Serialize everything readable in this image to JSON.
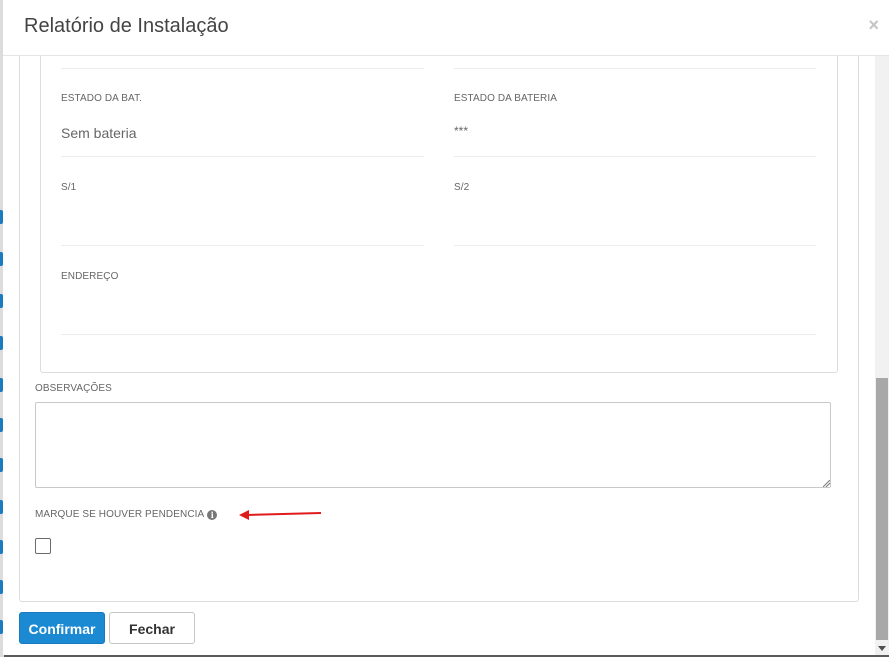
{
  "modal": {
    "title": "Relatório de Instalação",
    "close_glyph": "×"
  },
  "fields": {
    "estado_bat": {
      "label": "ESTADO DA BAT.",
      "value": "Sem bateria"
    },
    "estado_bateria": {
      "label": "ESTADO DA BATERIA",
      "value": "***"
    },
    "s1": {
      "label": "S/1",
      "value": ""
    },
    "s2": {
      "label": "S/2",
      "value": ""
    },
    "endereco": {
      "label": "ENDEREÇO",
      "value": ""
    }
  },
  "observacoes": {
    "label": "OBSERVAÇÕES",
    "value": ""
  },
  "pendencia": {
    "label": "MARQUE SE HOUVER PENDENCIA",
    "info_glyph": "i",
    "checked": false
  },
  "buttons": {
    "confirm": "Confirmar",
    "close": "Fechar"
  },
  "colors": {
    "primary": "#1b8ad3",
    "annotation_arrow": "#e01b1b"
  }
}
